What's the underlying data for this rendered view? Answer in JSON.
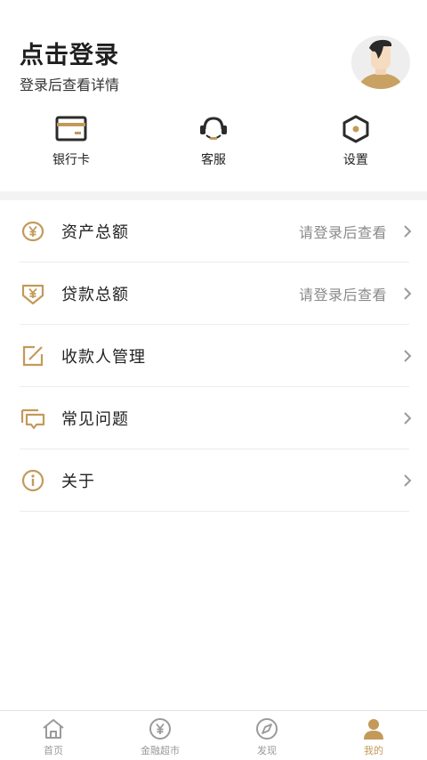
{
  "colors": {
    "accent": "#c39a5a",
    "text": "#222222",
    "muted": "#8a8a8a",
    "icon_dark": "#2b2b2b"
  },
  "header": {
    "title": "点击登录",
    "subtitle": "登录后查看详情",
    "avatar_icon": "user-avatar-illustration"
  },
  "quick_actions": [
    {
      "label": "银行卡",
      "icon": "bank-card-icon"
    },
    {
      "label": "客服",
      "icon": "headset-icon"
    },
    {
      "label": "设置",
      "icon": "settings-hexagon-icon"
    }
  ],
  "menu": [
    {
      "label": "资产总额",
      "hint": "请登录后查看",
      "icon": "yen-coin-icon"
    },
    {
      "label": "贷款总额",
      "hint": "请登录后查看",
      "icon": "yen-shield-icon"
    },
    {
      "label": "收款人管理",
      "hint": "",
      "icon": "edit-square-icon"
    },
    {
      "label": "常见问题",
      "hint": "",
      "icon": "chat-bubbles-icon"
    },
    {
      "label": "关于",
      "hint": "",
      "icon": "info-circle-icon"
    }
  ],
  "tabbar": [
    {
      "label": "首页",
      "icon": "home-icon",
      "active": false
    },
    {
      "label": "金融超市",
      "icon": "yen-circle-icon",
      "active": false
    },
    {
      "label": "发现",
      "icon": "compass-icon",
      "active": false
    },
    {
      "label": "我的",
      "icon": "person-icon",
      "active": true
    }
  ]
}
